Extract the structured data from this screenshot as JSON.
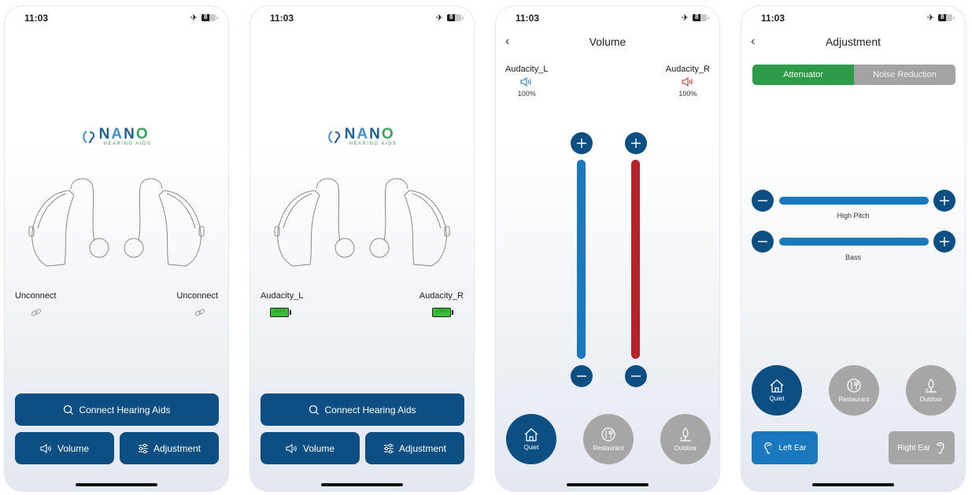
{
  "status_bar": {
    "time": "11:03",
    "battery": "8"
  },
  "brand": {
    "name": "NANO",
    "tagline": "HEARING AIDS"
  },
  "screens": {
    "home_disconnected": {
      "left": {
        "label": "Unconnect",
        "icon": "link-icon"
      },
      "right": {
        "label": "Unconnect",
        "icon": "link-icon"
      },
      "buttons": {
        "connect": "Connect Hearing Aids",
        "volume": "Volume",
        "adjustment": "Adjustment"
      }
    },
    "home_connected": {
      "left": {
        "label": "Audacity_L",
        "battery": "100%"
      },
      "right": {
        "label": "Audacity_R",
        "battery": "100%"
      },
      "buttons": {
        "connect": "Connect Hearing Aids",
        "volume": "Volume",
        "adjustment": "Adjustment"
      }
    },
    "volume": {
      "title": "Volume",
      "left": {
        "label": "Audacity_L",
        "percent": "100%",
        "level": 1.0,
        "color": "#1a78bf"
      },
      "right": {
        "label": "Audacity_R",
        "percent": "100%",
        "level": 1.0,
        "color": "#b5232a"
      },
      "modes": [
        {
          "label": "Quiet",
          "icon": "house-icon",
          "active": true
        },
        {
          "label": "Restaurant",
          "icon": "dining-icon",
          "active": false
        },
        {
          "label": "Outdoor",
          "icon": "tree-icon",
          "active": false
        }
      ]
    },
    "adjustment": {
      "title": "Adjustment",
      "tabs": [
        {
          "label": "Attenuator",
          "active": true
        },
        {
          "label": "Noise Reduction",
          "active": false
        }
      ],
      "sliders": [
        {
          "label": "High Pitch",
          "level": 1.0
        },
        {
          "label": "Bass",
          "level": 1.0
        }
      ],
      "modes": [
        {
          "label": "Quiet",
          "icon": "house-icon",
          "active": true
        },
        {
          "label": "Restaurant",
          "icon": "dining-icon",
          "active": false
        },
        {
          "label": "Outdoor",
          "icon": "tree-icon",
          "active": false
        }
      ],
      "ears": {
        "left": "Left Ear",
        "right": "Right Ear",
        "selected": "left"
      }
    }
  },
  "colors": {
    "primary": "#0d4f82",
    "accent_blue": "#1a78bf",
    "accent_red": "#b5232a",
    "green": "#2e9b48",
    "inactive": "#a6a6a6"
  }
}
